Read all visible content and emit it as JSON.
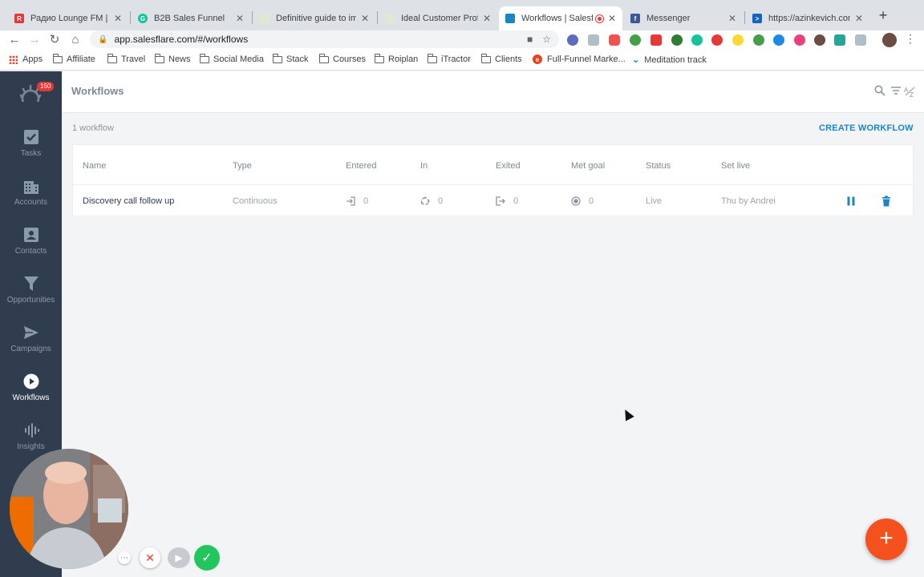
{
  "browser": {
    "tabs": [
      {
        "label": "Радио Lounge FM | Li",
        "favicon": "radio-favicon",
        "favicon_color": "#e53935"
      },
      {
        "label": "B2B Sales Funnel",
        "favicon": "grammarly-favicon",
        "favicon_color": "#15c39a"
      },
      {
        "label": "Definitive guide to imp",
        "favicon": "salesflare-favicon",
        "favicon_color": "#8bc34a"
      },
      {
        "label": "Ideal Customer Profile",
        "favicon": "salesflare-favicon",
        "favicon_color": "#8bc34a"
      },
      {
        "label": "Workflows | Salesf",
        "favicon": "salesflare-favicon",
        "favicon_color": "#1a86c6",
        "active": true,
        "recording": true
      },
      {
        "label": "Messenger",
        "favicon": "facebook-favicon",
        "favicon_color": "#3b5998"
      },
      {
        "label": "https://azinkevich.com",
        "favicon": "powershell-favicon",
        "favicon_color": "#1565c0"
      }
    ],
    "url": "app.salesflare.com/#/workflows",
    "bookmarks": [
      "Apps",
      "Affiliate",
      "Travel",
      "News",
      "Social Media",
      "Stack",
      "Courses",
      "Roiplan",
      "iTractor",
      "Clients",
      "Full-Funnel Marke...",
      "Meditation track"
    ]
  },
  "app": {
    "notification_count": "150",
    "nav": [
      {
        "label": "Tasks",
        "icon": "checkbox-icon"
      },
      {
        "label": "Accounts",
        "icon": "building-icon"
      },
      {
        "label": "Contacts",
        "icon": "contact-card-icon"
      },
      {
        "label": "Opportunities",
        "icon": "funnel-icon"
      },
      {
        "label": "Campaigns",
        "icon": "paper-plane-icon"
      },
      {
        "label": "Workflows",
        "icon": "play-circle-icon",
        "active": true
      },
      {
        "label": "Insights",
        "icon": "sound-wave-icon"
      }
    ],
    "page_title": "Workflows",
    "workflow_count": "1 workflow",
    "create_button": "CREATE WORKFLOW",
    "table": {
      "columns": [
        "Name",
        "Type",
        "Entered",
        "In",
        "Exited",
        "Met goal",
        "Status",
        "Set live"
      ],
      "rows": [
        {
          "name": "Discovery call follow up",
          "type": "Continuous",
          "entered": "0",
          "in": "0",
          "exited": "0",
          "met_goal": "0",
          "status": "Live",
          "set_live": "Thu by Andrei"
        }
      ]
    },
    "fab_label": "+",
    "colors": {
      "accent": "#1a86c6",
      "sidebar": "#2f3d4e",
      "fab": "#f4511e",
      "delete": "#1a86c6"
    }
  }
}
